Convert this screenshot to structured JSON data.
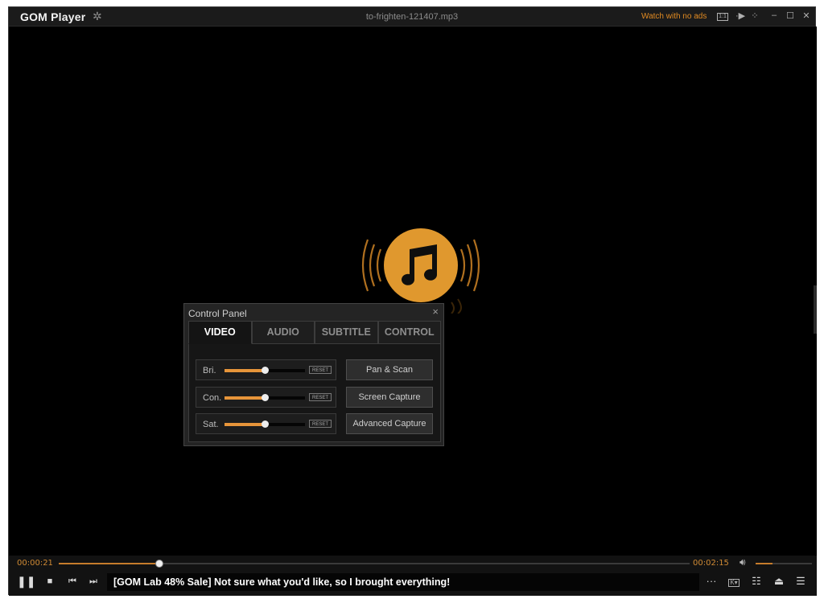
{
  "titlebar": {
    "app_name": "GOM Player",
    "gear_icon": "gear-icon",
    "file_title": "to-frighten-121407.mp3",
    "promo": "Watch with no ads",
    "icons": [
      "subtitle-box-icon",
      "play-small-icon",
      "fullscreen-icon",
      "minimize-icon",
      "maximize-icon",
      "close-icon"
    ]
  },
  "music_icon": {
    "name": "music-note-icon",
    "accent": "#e0982e"
  },
  "control_panel": {
    "title": "Control Panel",
    "tabs": [
      {
        "label": "VIDEO",
        "active": true
      },
      {
        "label": "AUDIO",
        "active": false
      },
      {
        "label": "SUBTITLE",
        "active": false
      },
      {
        "label": "CONTROL",
        "active": false
      }
    ],
    "sliders": [
      {
        "label": "Bri.",
        "value": 0.5,
        "reset": "RESET"
      },
      {
        "label": "Con.",
        "value": 0.5,
        "reset": "RESET"
      },
      {
        "label": "Sat.",
        "value": 0.5,
        "reset": "RESET"
      }
    ],
    "buttons": [
      "Pan & Scan",
      "Screen Capture",
      "Advanced Capture"
    ]
  },
  "playback": {
    "current_time": "00:00:21",
    "total_time": "00:02:15",
    "progress": 0.16,
    "volume": 0.3,
    "ticker": "[GOM Lab 48% Sale] Not sure what you'd like, so I brought everything!"
  },
  "colors": {
    "accent": "#e7953a",
    "background": "#000000",
    "panel": "#242424"
  }
}
